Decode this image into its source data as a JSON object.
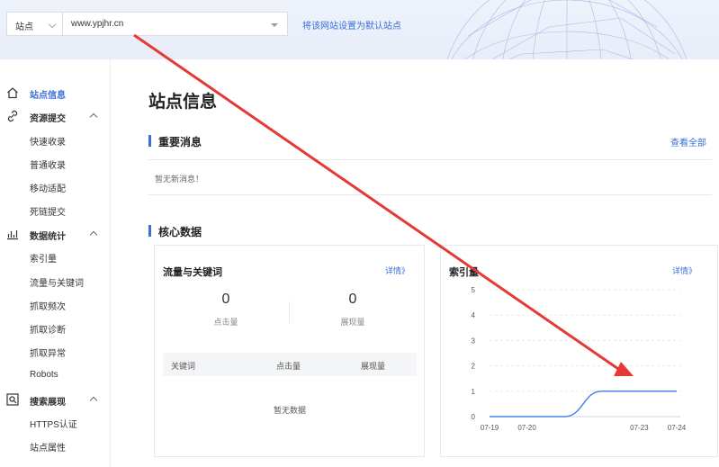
{
  "topbar": {
    "site_label": "站点",
    "domain_value": "www.ypjhr.cn",
    "set_default_link": "将该网站设置为默认站点"
  },
  "sidebar": {
    "items": [
      {
        "label": "站点信息",
        "icon": "home-icon",
        "active": true,
        "group": true
      },
      {
        "label": "资源提交",
        "icon": "link-icon",
        "group": true
      },
      {
        "label": "快速收录"
      },
      {
        "label": "普通收录"
      },
      {
        "label": "移动适配"
      },
      {
        "label": "死链提交"
      },
      {
        "label": "数据统计",
        "icon": "chart-icon",
        "group": true
      },
      {
        "label": "索引量"
      },
      {
        "label": "流量与关键词"
      },
      {
        "label": "抓取频次"
      },
      {
        "label": "抓取诊断"
      },
      {
        "label": "抓取异常"
      },
      {
        "label": "Robots"
      },
      {
        "label": "搜索展现",
        "icon": "search-icon",
        "group": true
      },
      {
        "label": "HTTPS认证"
      },
      {
        "label": "站点属性"
      }
    ]
  },
  "main": {
    "page_title": "站点信息",
    "important_title": "重要消息",
    "view_all": "查看全部",
    "no_messages": "暂无新消息！",
    "core_title": "核心数据",
    "traffic_card": {
      "title": "流量与关键词",
      "detail_link": "详情》",
      "clicks_value": "0",
      "clicks_label": "点击量",
      "impressions_value": "0",
      "impressions_label": "展现量",
      "col_keyword": "关键词",
      "col_clicks": "点击量",
      "col_impressions": "展现量",
      "empty_text": "暂无数据"
    },
    "index_card": {
      "title": "索引量",
      "detail_link": "详情》"
    }
  },
  "colors": {
    "accent": "#3a6fd8",
    "arrow": "#e53935",
    "line": "#4a86e8"
  },
  "chart_data": {
    "type": "line",
    "x_labels": [
      "07-19",
      "07-20",
      "07-23",
      "07-24"
    ],
    "x": [
      "07-19",
      "07-20",
      "07-21",
      "07-22",
      "07-23",
      "07-24"
    ],
    "series": [
      {
        "values": [
          0,
          0,
          0,
          1,
          1,
          1
        ]
      }
    ],
    "ylim": [
      0,
      5
    ],
    "yticks": [
      0,
      1,
      2,
      3,
      4,
      5
    ],
    "grid": true
  }
}
